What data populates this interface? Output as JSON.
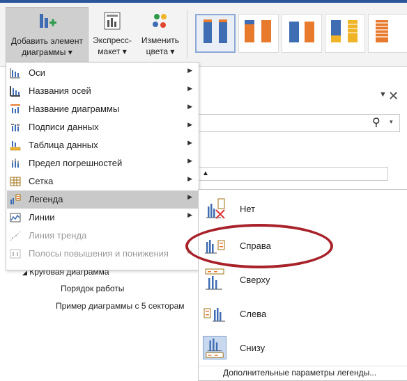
{
  "ribbon": {
    "add_element": {
      "line1": "Добавить элемент",
      "line2": "диаграммы ▾"
    },
    "express": {
      "line1": "Экспресс-",
      "line2": "макет ▾"
    },
    "colors": {
      "line1": "Изменить",
      "line2": "цвета ▾"
    },
    "accent": "#2b579a",
    "gallery_colors": [
      "#3f6db3",
      "#e87a2e",
      "#f0b428"
    ]
  },
  "pane": {
    "tree_parent": "Круговая диаграмма",
    "tree_children": [
      "Порядок работы",
      "Пример диаграммы с 5 секторам"
    ]
  },
  "menu": {
    "items": [
      {
        "label": "Оси",
        "icon": "axes-icon",
        "disabled": false
      },
      {
        "label": "Названия осей",
        "icon": "axis-titles-icon",
        "disabled": false
      },
      {
        "label": "Название диаграммы",
        "icon": "chart-title-icon",
        "disabled": false
      },
      {
        "label": "Подписи данных",
        "icon": "data-labels-icon",
        "disabled": false
      },
      {
        "label": "Таблица данных",
        "icon": "data-table-icon",
        "disabled": false
      },
      {
        "label": "Предел погрешностей",
        "icon": "error-bars-icon",
        "disabled": false
      },
      {
        "label": "Сетка",
        "icon": "gridlines-icon",
        "disabled": false
      },
      {
        "label": "Легенда",
        "icon": "legend-icon",
        "disabled": false
      },
      {
        "label": "Линии",
        "icon": "lines-icon",
        "disabled": false
      },
      {
        "label": "Линия тренда",
        "icon": "trendline-icon",
        "disabled": true
      },
      {
        "label": "Полосы повышения и понижения",
        "icon": "up-down-bars-icon",
        "disabled": true
      }
    ]
  },
  "submenu": {
    "items": [
      {
        "label": "Нет",
        "icon": "legend-none-icon"
      },
      {
        "label": "Справа",
        "icon": "legend-right-icon"
      },
      {
        "label": "Сверху",
        "icon": "legend-top-icon"
      },
      {
        "label": "Слева",
        "icon": "legend-left-icon"
      },
      {
        "label": "Снизу",
        "icon": "legend-bottom-icon"
      }
    ],
    "more": "Дополнительные параметры легенды...",
    "selected": "Снизу",
    "highlight_color": "#a8222a"
  }
}
